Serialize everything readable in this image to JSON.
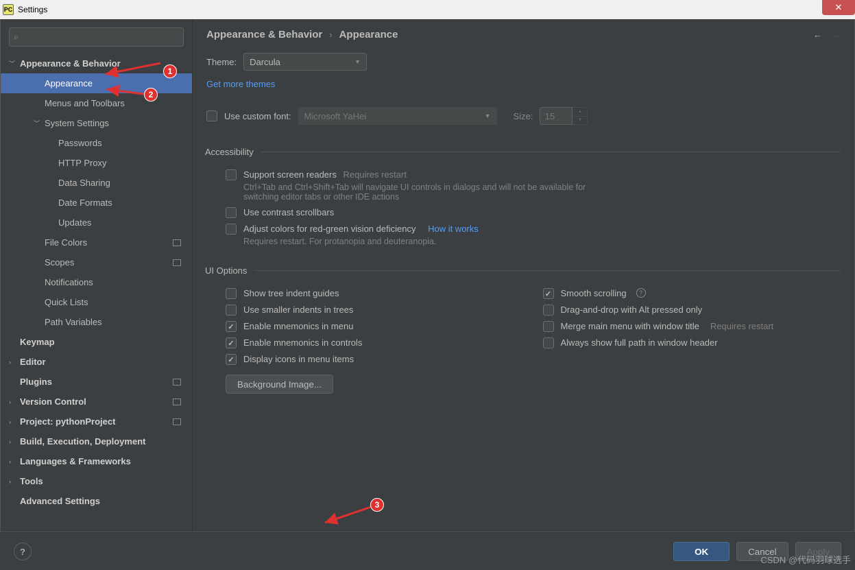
{
  "window": {
    "title": "Settings",
    "close_icon": "✕"
  },
  "search": {
    "icon": "⌕",
    "placeholder": ""
  },
  "sidebar": {
    "items": [
      {
        "label": "Appearance & Behavior",
        "level": 1,
        "bold": true,
        "expandable": true,
        "expanded": true
      },
      {
        "label": "Appearance",
        "level": 2,
        "selected": true
      },
      {
        "label": "Menus and Toolbars",
        "level": 2
      },
      {
        "label": "System Settings",
        "level": 2,
        "expandable": true,
        "expanded": true
      },
      {
        "label": "Passwords",
        "level": 3
      },
      {
        "label": "HTTP Proxy",
        "level": 3
      },
      {
        "label": "Data Sharing",
        "level": 3
      },
      {
        "label": "Date Formats",
        "level": 3
      },
      {
        "label": "Updates",
        "level": 3
      },
      {
        "label": "File Colors",
        "level": 2,
        "tag": true
      },
      {
        "label": "Scopes",
        "level": 2,
        "tag": true
      },
      {
        "label": "Notifications",
        "level": 2
      },
      {
        "label": "Quick Lists",
        "level": 2
      },
      {
        "label": "Path Variables",
        "level": 2
      },
      {
        "label": "Keymap",
        "level": 1,
        "bold": true
      },
      {
        "label": "Editor",
        "level": 1,
        "bold": true,
        "expandable": true
      },
      {
        "label": "Plugins",
        "level": 1,
        "bold": true,
        "tag": true
      },
      {
        "label": "Version Control",
        "level": 1,
        "bold": true,
        "expandable": true,
        "tag": true
      },
      {
        "label": "Project: pythonProject",
        "level": 1,
        "bold": true,
        "expandable": true,
        "tag": true
      },
      {
        "label": "Build, Execution, Deployment",
        "level": 1,
        "bold": true,
        "expandable": true
      },
      {
        "label": "Languages & Frameworks",
        "level": 1,
        "bold": true,
        "expandable": true
      },
      {
        "label": "Tools",
        "level": 1,
        "bold": true,
        "expandable": true
      },
      {
        "label": "Advanced Settings",
        "level": 1,
        "bold": true
      }
    ]
  },
  "breadcrumb": {
    "root": "Appearance & Behavior",
    "sep": "›",
    "leaf": "Appearance"
  },
  "theme": {
    "label": "Theme:",
    "value": "Darcula",
    "more_link": "Get more themes"
  },
  "font": {
    "checkbox_label": "Use custom font:",
    "value": "Microsoft YaHei",
    "size_label": "Size:",
    "size_value": "15"
  },
  "accessibility": {
    "legend": "Accessibility",
    "screen_readers": "Support screen readers",
    "screen_readers_hint": "Requires restart",
    "screen_readers_sub": "Ctrl+Tab and Ctrl+Shift+Tab will navigate UI controls in dialogs and will not be available for switching editor tabs or other IDE actions",
    "contrast": "Use contrast scrollbars",
    "color_adjust": "Adjust colors for red-green vision deficiency",
    "how_link": "How it works",
    "color_sub": "Requires restart. For protanopia and deuteranopia."
  },
  "ui": {
    "legend": "UI Options",
    "tree_guides": "Show tree indent guides",
    "smaller_indents": "Use smaller indents in trees",
    "mnemonics_menu": "Enable mnemonics in menu",
    "mnemonics_controls": "Enable mnemonics in controls",
    "display_icons": "Display icons in menu items",
    "smooth_scroll": "Smooth scrolling",
    "drag_alt": "Drag-and-drop with Alt pressed only",
    "merge_menu": "Merge main menu with window title",
    "merge_hint": "Requires restart",
    "full_path": "Always show full path in window header",
    "bg_image": "Background Image..."
  },
  "footer": {
    "ok": "OK",
    "cancel": "Cancel",
    "apply": "Apply"
  },
  "annotations": {
    "n1": "1",
    "n2": "2",
    "n3": "3"
  },
  "watermark": "CSDN @代码羽球选手"
}
